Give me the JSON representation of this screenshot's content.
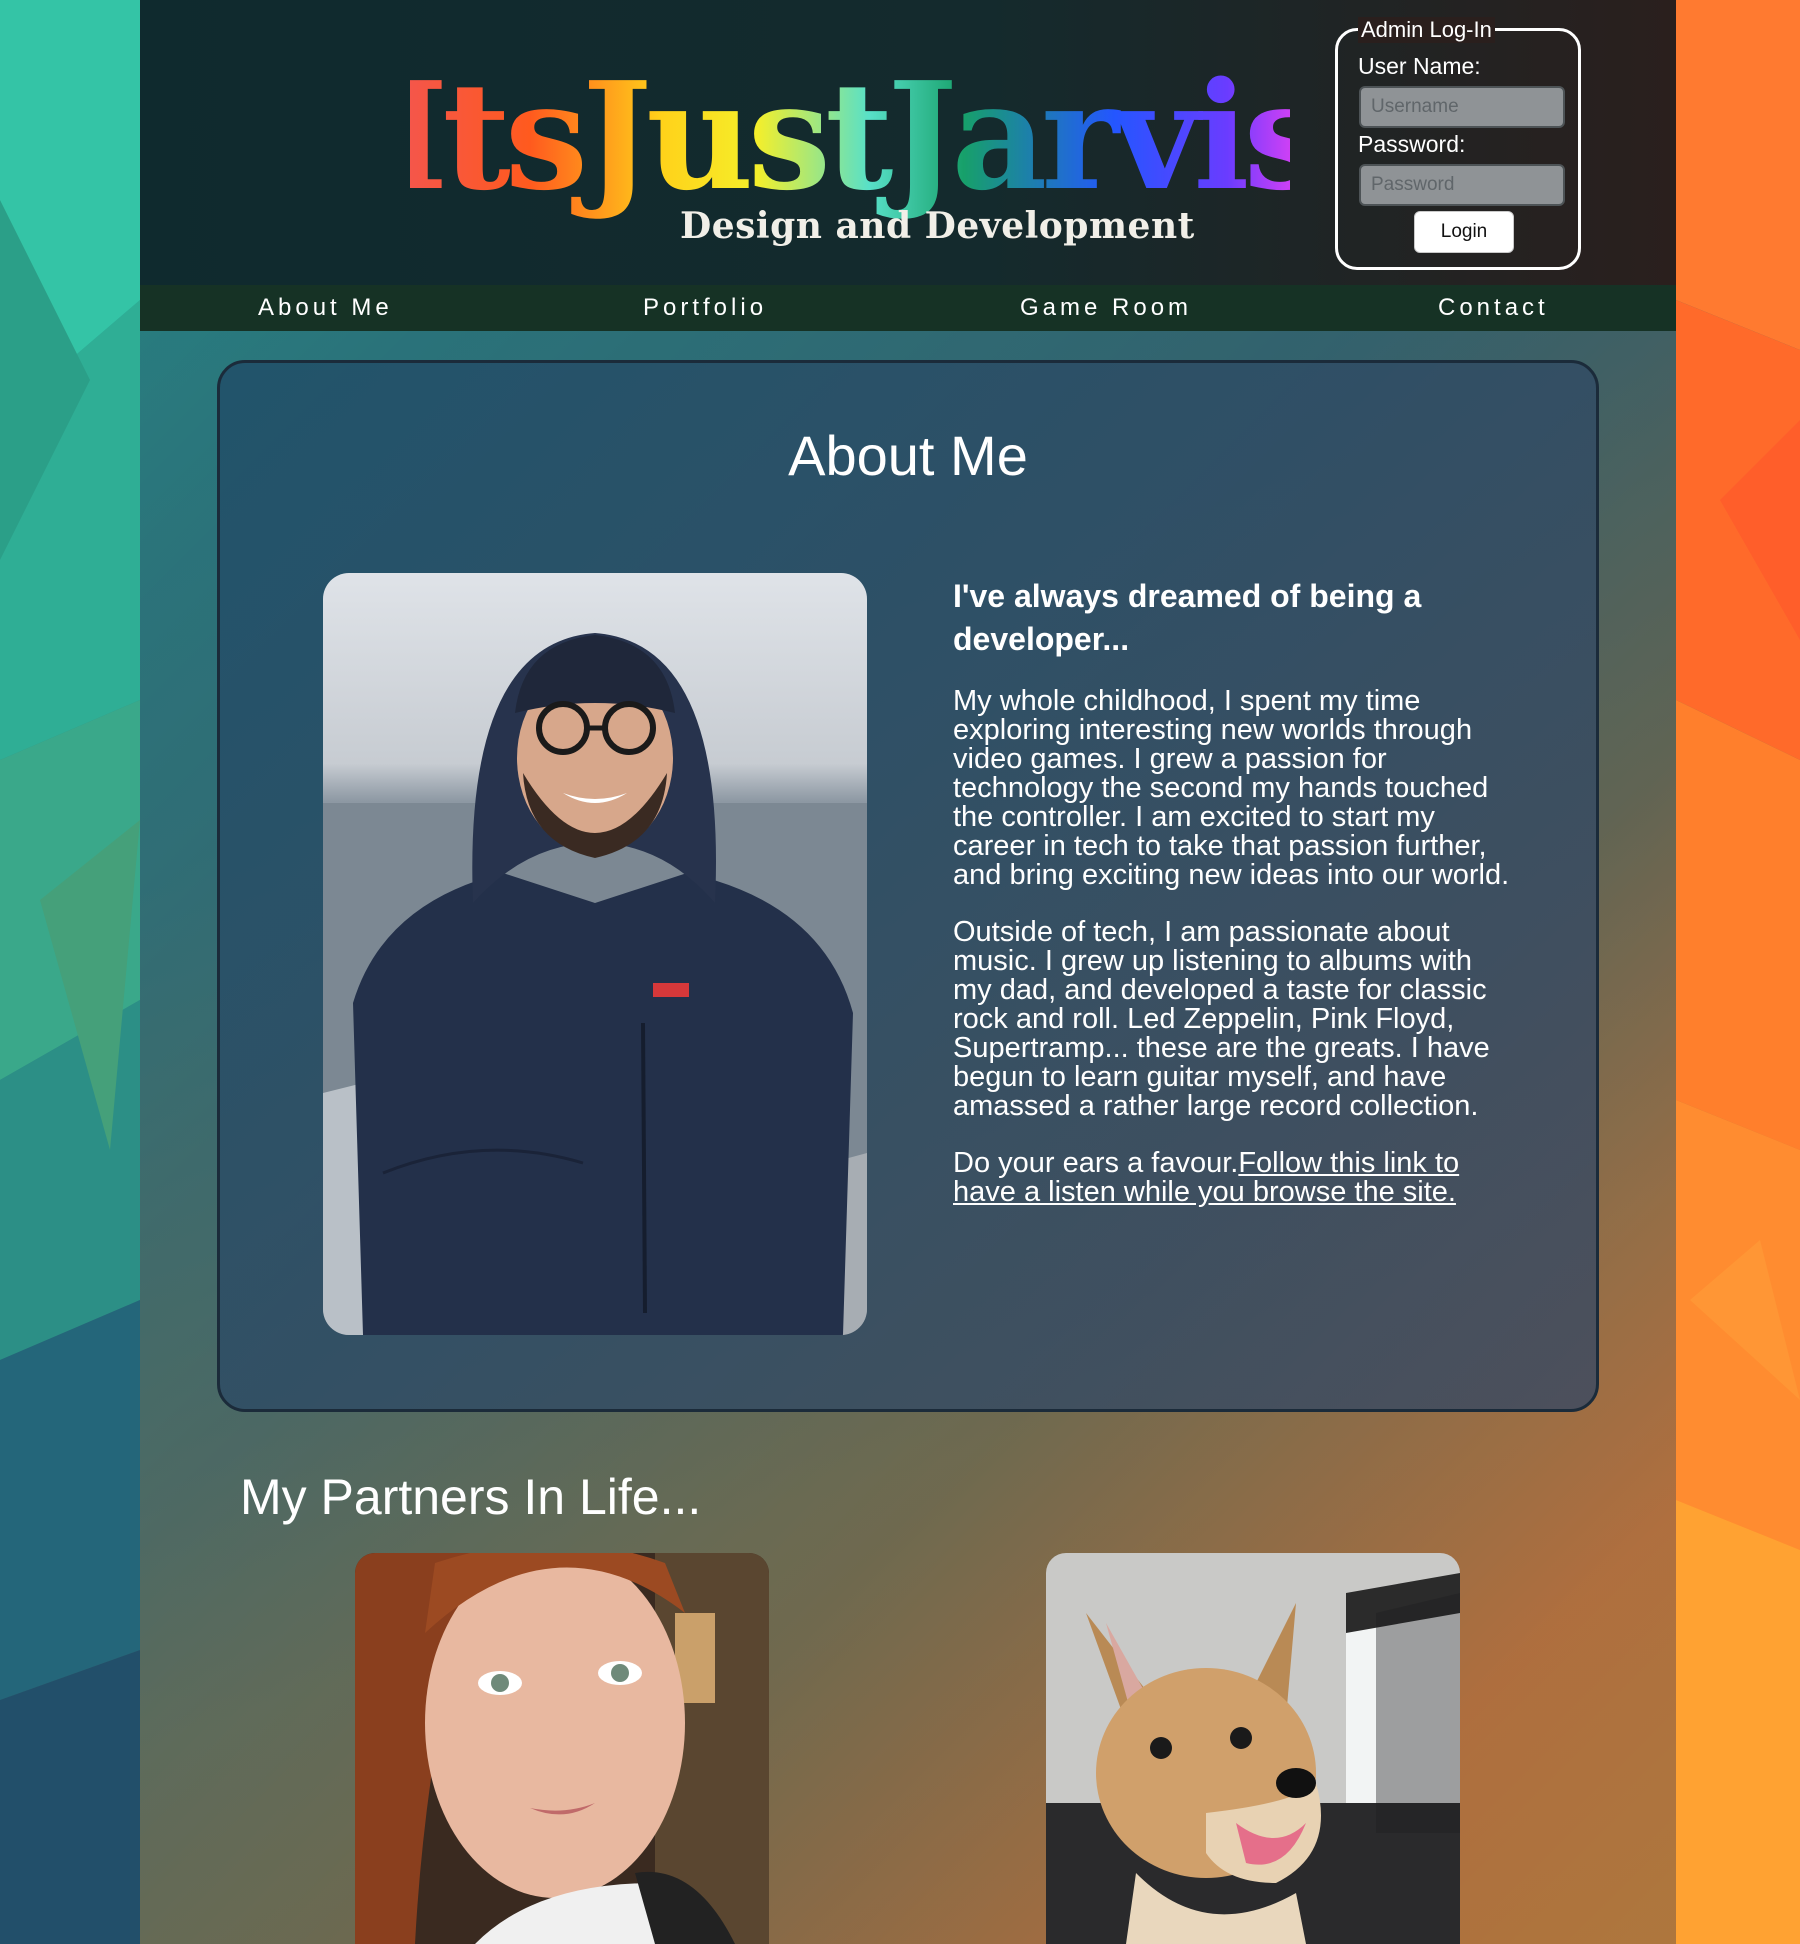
{
  "header": {
    "logo_text": "ItsJustJarvis",
    "tagline": "Design and Development"
  },
  "admin": {
    "legend": "Admin Log-In",
    "username_label": "User Name:",
    "username_placeholder": "Username",
    "password_label": "Password:",
    "password_placeholder": "Password",
    "login_label": "Login"
  },
  "nav": {
    "items": [
      {
        "label": "About Me"
      },
      {
        "label": "Portfolio"
      },
      {
        "label": "Game Room"
      },
      {
        "label": "Contact"
      }
    ]
  },
  "about": {
    "title": "About Me",
    "heading": "I've always dreamed of being a developer...",
    "para1": "My whole childhood, I spent my time exploring interesting new worlds through video games. I grew a passion for technology the second my hands touched the controller. I am excited to start my career in tech to take that passion further, and bring exciting new ideas into our world.",
    "para2": "Outside of tech, I am passionate about music. I grew up listening to albums with my dad, and developed a taste for classic rock and roll. Led Zeppelin, Pink Floyd, Supertramp... these are the greats. I have begun to learn guitar myself, and have amassed a rather large record collection.",
    "para3_lead": "Do your ears a favour.",
    "para3_link": "Follow this link to have a listen while you browse the site."
  },
  "partners": {
    "title": "My Partners In Life..."
  },
  "colors": {
    "nav_bg": "#163225",
    "header_bg": "#142a2d",
    "panel_border": "#1b2b3a"
  }
}
